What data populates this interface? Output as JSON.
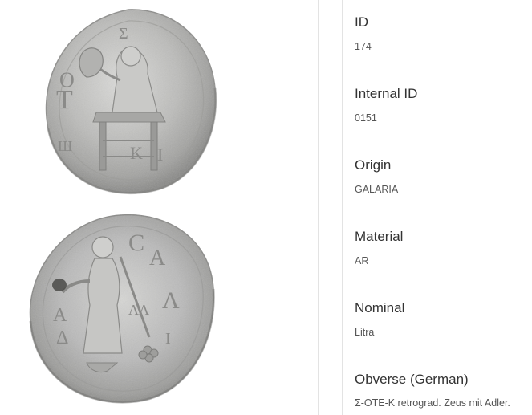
{
  "fields": [
    {
      "label": "ID",
      "value": "174"
    },
    {
      "label": "Internal ID",
      "value": "0151"
    },
    {
      "label": "Origin",
      "value": "GALARIA"
    },
    {
      "label": "Material",
      "value": "AR"
    },
    {
      "label": "Nominal",
      "value": "Litra"
    },
    {
      "label": "Obverse (German)",
      "value": "Σ-OTE-K retrograd. Zeus mit Adler."
    }
  ],
  "colors": {
    "label": "#333333",
    "value": "#555555",
    "divider": "#e3e3e3",
    "coin_silver": "#b9b9b7"
  },
  "images": [
    {
      "name": "coin-obverse-image"
    },
    {
      "name": "coin-reverse-image"
    }
  ]
}
